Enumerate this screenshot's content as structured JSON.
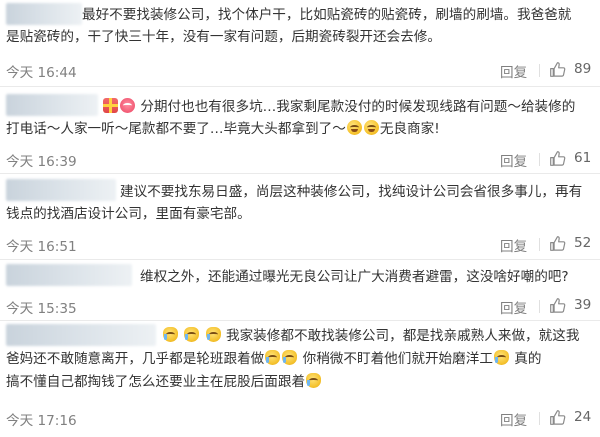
{
  "comments": [
    {
      "lines": [
        "最好不要找装修公司，找个体户干，比如贴瓷砖的贴瓷砖，刷墙的刷墙。我爸爸就",
        "是贴瓷砖的，干了快三十年，没有一家有问题，后期瓷砖裂开还会去修。"
      ],
      "time": "今天 16:44",
      "reply": "回复",
      "likes": "89"
    },
    {
      "lines": [
        "分期付也也有很多坑…我家剩尾款没付的时候发现线路有问题～给装修的",
        "打电话～人家一听～尾款都不要了…毕竟大头都拿到了～",
        "无良商家!"
      ],
      "time": "今天 16:39",
      "reply": "回复",
      "likes": "61"
    },
    {
      "lines": [
        "建议不要找东易日盛，尚层这种装修公司，找纯设计公司会省很多事儿，再有",
        "钱点的找酒店设计公司，里面有豪宅部。"
      ],
      "time": "今天 16:51",
      "reply": "回复",
      "likes": "52"
    },
    {
      "lines": [
        "维权之外，还能通过曝光无良公司让广大消费者避雷，这没啥好嘲的吧?"
      ],
      "time": "今天 15:35",
      "reply": "回复",
      "likes": "39"
    },
    {
      "lines": [
        "我家装修都不敢找装修公司，都是找亲戚熟人来做，就这我",
        "爸妈还不敢随意离开，几乎都是轮班跟着做",
        "你稍微不盯着他们就开始磨洋工",
        "真的",
        "搞不懂自己都掏钱了怎么还要业主在屁股后面跟着"
      ],
      "time": "今天 17:16",
      "reply": "回复",
      "likes": "24"
    }
  ],
  "icons": {
    "like": "thumbs-up-icon",
    "emoji_laugh": "laugh-emoji-icon",
    "emoji_cry": "cry-emoji-icon"
  },
  "colors": {
    "text": "#333333",
    "meta": "#808080",
    "divider": "#eaeaea"
  }
}
